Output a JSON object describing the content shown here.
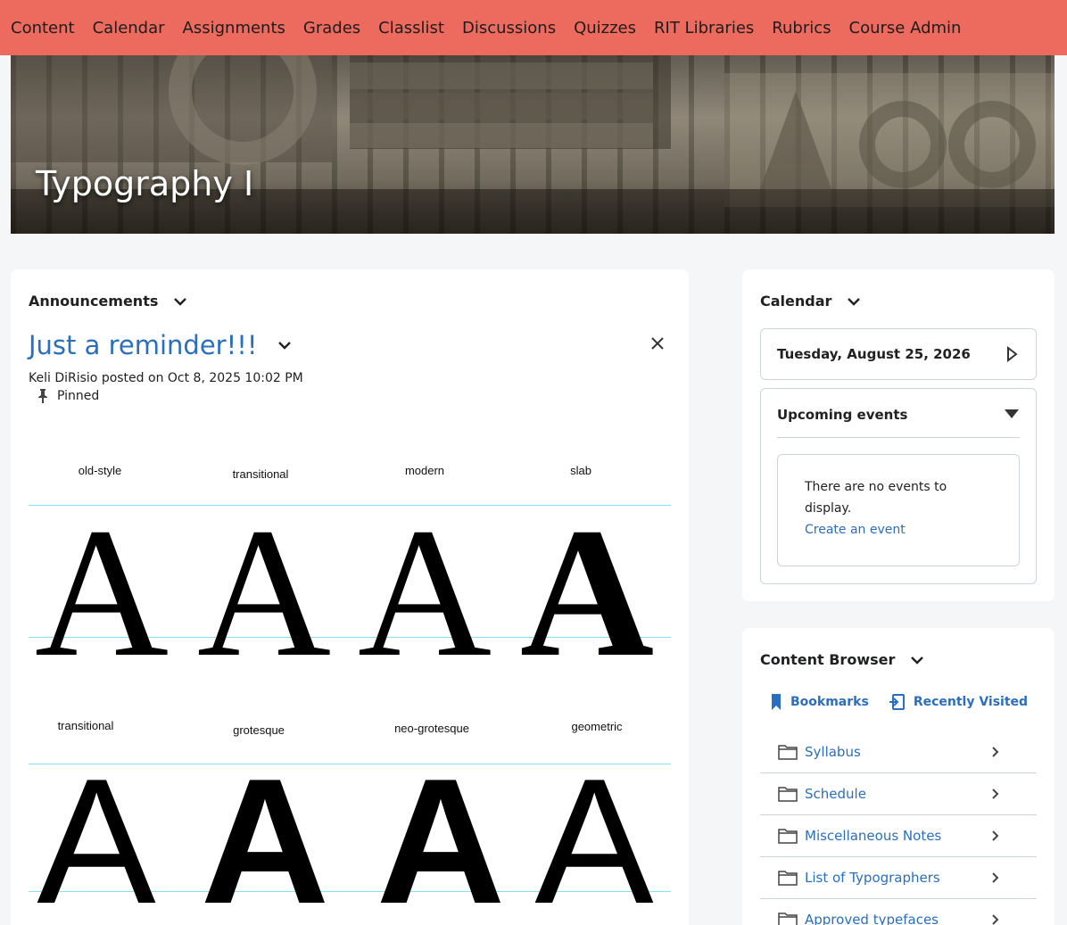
{
  "nav": [
    "Content",
    "Calendar",
    "Assignments",
    "Grades",
    "Classlist",
    "Discussions",
    "Quizzes",
    "RIT Libraries",
    "Rubrics",
    "Course Admin"
  ],
  "banner": {
    "title": "Typography I"
  },
  "announcements": {
    "heading": "Announcements",
    "title": "Just a reminder!!!",
    "meta": "Keli DiRisio posted on Oct 8, 2025 10:02 PM",
    "pinned": "Pinned",
    "figure": {
      "row1": [
        "old-style",
        "transitional",
        "modern",
        "slab"
      ],
      "row2": [
        "transitional",
        "grotesque",
        "neo-grotesque",
        "geometric"
      ],
      "glyph": "A"
    }
  },
  "calendar": {
    "heading": "Calendar",
    "date": "Tuesday, August 25, 2026",
    "upcoming": "Upcoming events",
    "empty": "There are no events to display.",
    "create": "Create an event"
  },
  "content_browser": {
    "heading": "Content Browser",
    "tabs": [
      "Bookmarks",
      "Recently Visited"
    ],
    "items": [
      "Syllabus",
      "Schedule",
      "Miscellaneous Notes",
      "List of Typographers",
      "Approved typefaces"
    ]
  },
  "colors": {
    "nav_bg": "#ec6a5e",
    "link": "#2a6fbd",
    "guide_line": "#7fe3f0"
  }
}
